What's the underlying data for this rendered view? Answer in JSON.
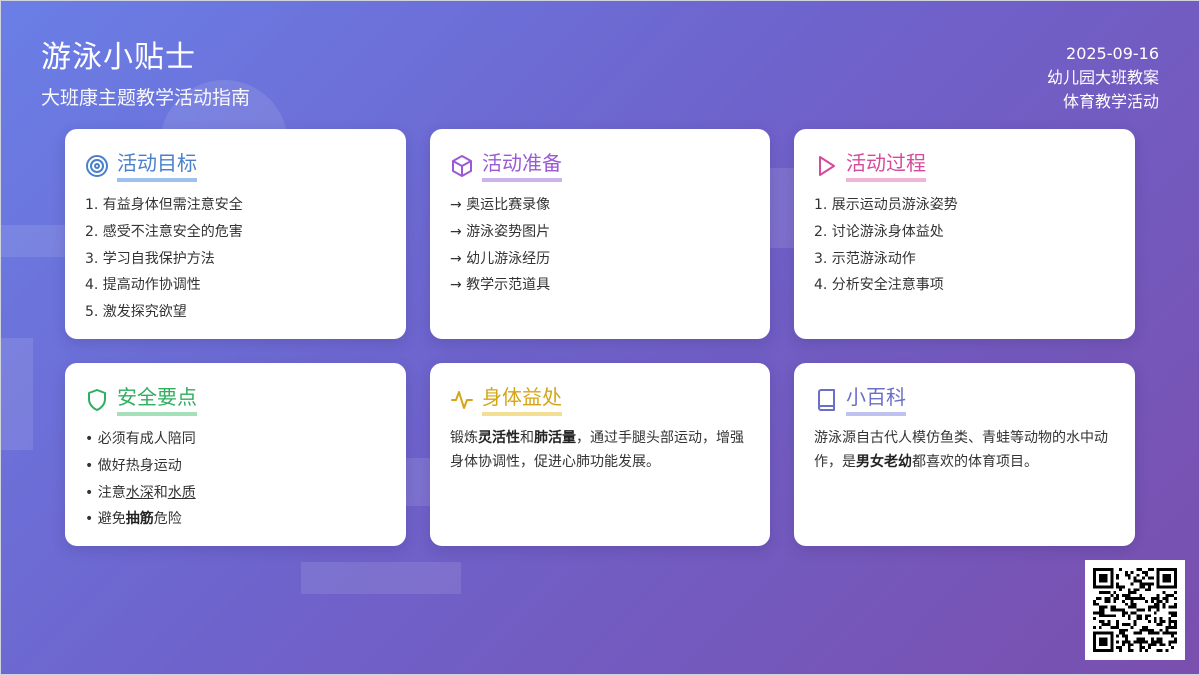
{
  "header": {
    "title": "游泳小贴士",
    "subtitle": "大班康主题教学活动指南",
    "date": "2025-09-16",
    "course": "幼儿园大班教案",
    "category": "体育教学活动"
  },
  "colors": {
    "blue": "#4a7fcc",
    "purple": "#9b59d6",
    "pink": "#d64a9b",
    "green": "#2fae5e",
    "gold": "#d4a517",
    "indigo": "#6b6fc8"
  },
  "cards": {
    "goals": {
      "icon": "target-icon",
      "title": "活动目标",
      "items": [
        "1. 有益身体但需注意安全",
        "2. 感受不注意安全的危害",
        "3. 学习自我保护方法",
        "4. 提高动作协调性",
        "5. 激发探究欲望"
      ]
    },
    "prep": {
      "icon": "box-icon",
      "title": "活动准备",
      "items": [
        "→ 奥运比赛录像",
        "→ 游泳姿势图片",
        "→ 幼儿游泳经历",
        "→ 教学示范道具"
      ]
    },
    "process": {
      "icon": "play-icon",
      "title": "活动过程",
      "items": [
        "1. 展示运动员游泳姿势",
        "2. 讨论游泳身体益处",
        "3. 示范游泳动作",
        "4. 分析安全注意事项"
      ]
    },
    "safety": {
      "icon": "shield-icon",
      "title": "安全要点",
      "items": {
        "i1": "• 必须有成人陪同",
        "i2": "• 做好热身运动",
        "i3_a": "• 注意",
        "i3_b": "水深",
        "i3_c": "和",
        "i3_d": "水质",
        "i4_a": "• 避免",
        "i4_b": "抽筋",
        "i4_c": "危险"
      }
    },
    "benefits": {
      "icon": "pulse-icon",
      "title": "身体益处",
      "t1": "锻炼",
      "t2": "灵活性",
      "t3": "和",
      "t4": "肺活量",
      "t5": "，通过手腿头部运动，增强身体协调性，促进心肺功能发展。"
    },
    "wiki": {
      "icon": "book-icon",
      "title": "小百科",
      "t1": "游泳源自古代人模仿鱼类、青蛙等动物的水中动作，是",
      "t2": "男女老幼",
      "t3": "都喜欢的体育项目。"
    }
  },
  "qr": {
    "icon": "qr-code-icon"
  }
}
